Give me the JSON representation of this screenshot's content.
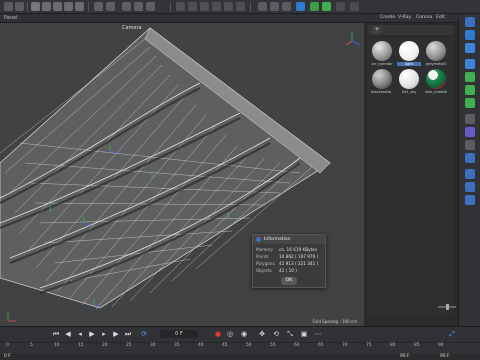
{
  "toolbar": {
    "icons": [
      "undo-icon",
      "redo-icon",
      "selection-icon",
      "move-icon",
      "scale-icon",
      "rotate-icon",
      "axis-x-icon",
      "axis-y-icon",
      "axis-z-icon",
      "coordinate-system-icon",
      "render-region-icon",
      "render-view-icon",
      "render-settings-icon",
      "cube-icon",
      "spline-pen-icon",
      "nurbs-icon",
      "array-icon",
      "deformer-icon",
      "floor-icon",
      "camera-icon",
      "light-icon"
    ]
  },
  "viewport": {
    "menu": {
      "panel": "Panel"
    },
    "camera_label": "Camera",
    "grid_spacing": "Grid Spacing : 100 cm"
  },
  "materials": {
    "menu": {
      "create": "Create",
      "vray": "V-Ray",
      "corona": "Corona",
      "edit": "Edit"
    },
    "items": [
      {
        "label": "arr_cylinder",
        "color": "#aaaaaa",
        "selected": false
      },
      {
        "label": "light",
        "color": "#f2f2f2",
        "selected": true
      },
      {
        "label": "greymetal3",
        "color": "#8f9192",
        "selected": false
      },
      {
        "label": "blackmetal_",
        "color": "#7d7f80",
        "selected": false
      },
      {
        "label": "Int1_sky",
        "color": "#e3e4e6",
        "selected": false
      },
      {
        "label": "side_marble",
        "color": "#1f8f55",
        "selected": false
      }
    ]
  },
  "timeline": {
    "frame_field": "0 F",
    "ruler_labels": [
      "0",
      "5",
      "10",
      "15",
      "20",
      "25",
      "30",
      "35",
      "40",
      "45",
      "50",
      "55",
      "60",
      "65",
      "70",
      "75",
      "80",
      "85",
      "90"
    ],
    "start": "0 F",
    "end_a": "90 F",
    "end_b": "90 F"
  },
  "dialog": {
    "title": "Information",
    "rows": [
      {
        "key": "Memory",
        "value": "ca. 16 619 KBytes"
      },
      {
        "key": "Points",
        "value": "10 862 ( 197 976 )"
      },
      {
        "key": "Polygons",
        "value": "45 913 ( 221 341 )"
      },
      {
        "key": "Objects",
        "value": "41 ( 10 )"
      }
    ],
    "ok_label": "OK"
  },
  "colors": {
    "accent": "#4a72b0",
    "viewport_bg": "#414243",
    "wire": "#d8d8d8",
    "axis_green": "#2fbf4a",
    "axis_blue": "#3366ff"
  }
}
